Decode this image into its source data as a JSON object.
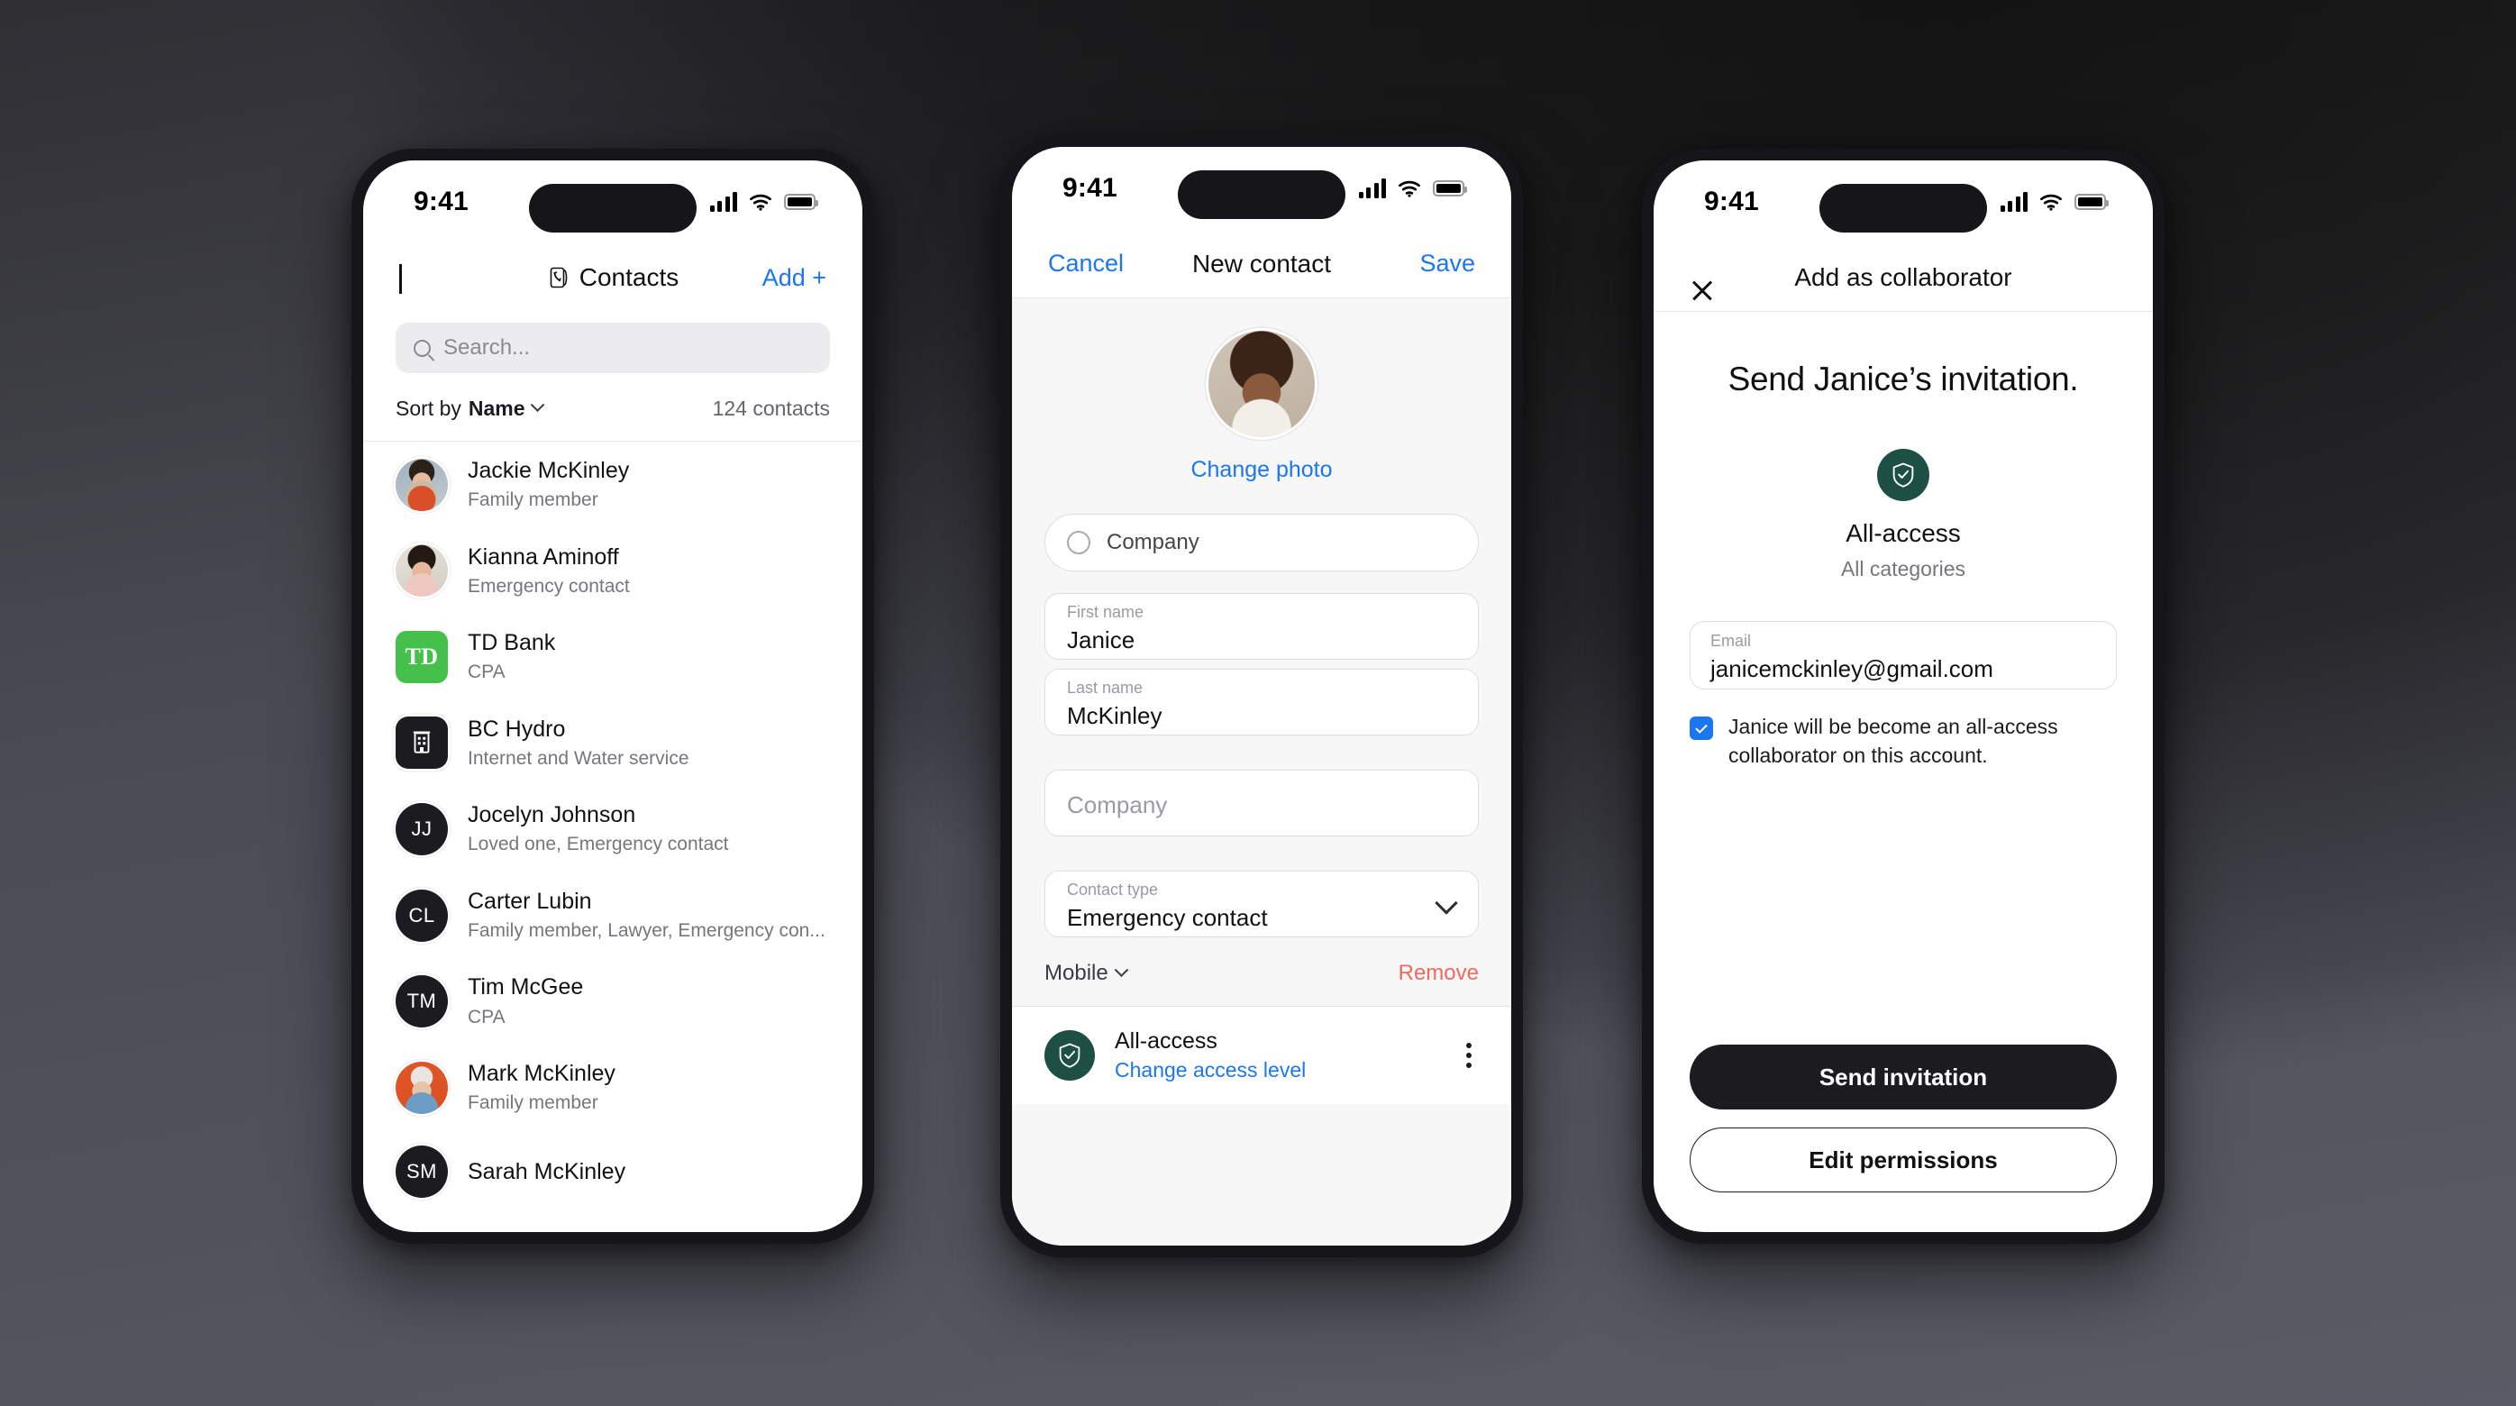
{
  "status_bar": {
    "time": "9:41",
    "cellular_icon": "signal-bars-icon",
    "wifi_icon": "wifi-icon",
    "battery_icon": "battery-icon"
  },
  "colors": {
    "accent_blue": "#1b76f2",
    "destructive_red": "#f3675e",
    "shield_green": "#1d4f45",
    "td_green": "#45c04a",
    "dark": "#1c1c20",
    "background_dark": "#1e1e1f"
  },
  "screen_contacts": {
    "nav": {
      "back_icon": "chevron-left-icon",
      "title_icon": "contact-book-icon",
      "title": "Contacts",
      "add_label": "Add +"
    },
    "search": {
      "placeholder": "Search...",
      "icon": "search-icon"
    },
    "sort": {
      "prefix": "Sort by",
      "value": "Name",
      "chevron_icon": "chevron-down-icon",
      "count": "124 contacts"
    },
    "contacts": [
      {
        "name": "Jackie McKinley",
        "subtitle": "Family member",
        "avatar_type": "photo",
        "avatar_class": "ph-jackie",
        "initials": ""
      },
      {
        "name": "Kianna Aminoff",
        "subtitle": "Emergency contact",
        "avatar_type": "photo",
        "avatar_class": "ph-kianna",
        "initials": ""
      },
      {
        "name": "TD Bank",
        "subtitle": "CPA",
        "avatar_type": "logo",
        "avatar_class": "td-logo",
        "initials": "TD"
      },
      {
        "name": "BC Hydro",
        "subtitle": "Internet and Water service",
        "avatar_type": "building",
        "avatar_class": "bld-icon",
        "initials": ""
      },
      {
        "name": "Jocelyn Johnson",
        "subtitle": "Loved one, Emergency contact",
        "avatar_type": "initials",
        "avatar_class": "",
        "initials": "JJ"
      },
      {
        "name": "Carter Lubin",
        "subtitle": "Family member, Lawyer, Emergency con...",
        "avatar_type": "initials",
        "avatar_class": "",
        "initials": "CL"
      },
      {
        "name": "Tim McGee",
        "subtitle": "CPA",
        "avatar_type": "initials",
        "avatar_class": "",
        "initials": "TM"
      },
      {
        "name": "Mark McKinley",
        "subtitle": "Family member",
        "avatar_type": "photo",
        "avatar_class": "ph-mark",
        "initials": ""
      },
      {
        "name": "Sarah McKinley",
        "subtitle": "",
        "avatar_type": "initials",
        "avatar_class": "",
        "initials": "SM"
      }
    ]
  },
  "screen_new_contact": {
    "nav": {
      "cancel_label": "Cancel",
      "title": "New contact",
      "save_label": "Save"
    },
    "photo": {
      "change_label": "Change photo",
      "avatar_name": "janice-photo"
    },
    "company_toggle": {
      "label": "Company",
      "radio_icon": "radio-unchecked-icon",
      "checked": false
    },
    "fields": [
      {
        "label": "First name",
        "value": "Janice",
        "is_placeholder": false
      },
      {
        "label": "Last name",
        "value": "McKinley",
        "is_placeholder": false
      }
    ],
    "company_field": {
      "placeholder": "Company",
      "value": ""
    },
    "contact_type": {
      "label": "Contact type",
      "value": "Emergency contact",
      "chevron_icon": "chevron-down-icon"
    },
    "phone_section": {
      "type_label": "Mobile",
      "type_chevron_icon": "chevron-down-icon",
      "remove_label": "Remove"
    },
    "access": {
      "icon": "shield-check-icon",
      "title": "All-access",
      "link": "Change access level",
      "menu_icon": "kebab-menu-icon"
    }
  },
  "screen_collaborator": {
    "nav": {
      "close_icon": "close-icon",
      "title": "Add as collaborator"
    },
    "heading": "Send Janice’s invitation.",
    "access": {
      "icon": "shield-check-icon",
      "title": "All-access",
      "subtitle": "All categories"
    },
    "email_field": {
      "label": "Email",
      "value": "janicemckinley@gmail.com"
    },
    "consent": {
      "checked": true,
      "text": "Janice will be become an all-access collaborator on this account."
    },
    "buttons": {
      "primary": "Send invitation",
      "secondary": "Edit permissions"
    }
  }
}
